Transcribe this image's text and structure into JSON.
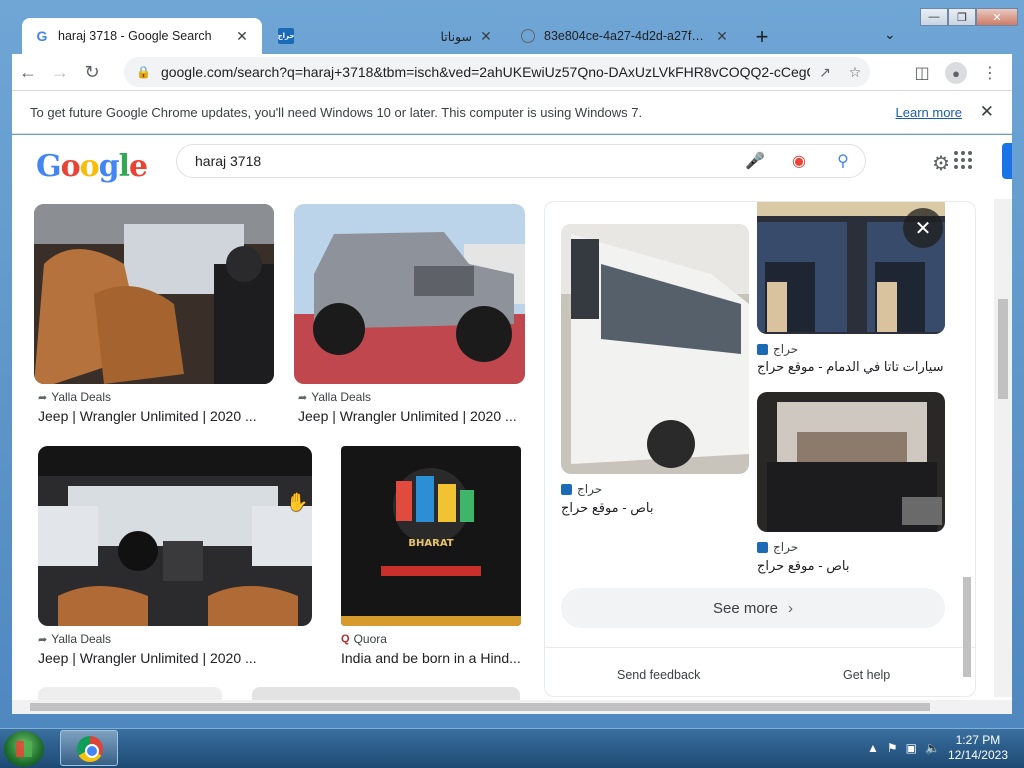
{
  "browser": {
    "tabs": [
      {
        "title": "haraj 3718 - Google Search",
        "favicon": "google-icon",
        "active": true
      },
      {
        "title": "",
        "favicon": "haraj-icon",
        "active": false
      },
      {
        "title": "سوناتا",
        "favicon": "none",
        "active": false
      },
      {
        "title": "83e804ce-4a27-4d2d-a27f-8e97",
        "favicon": "globe-icon",
        "active": false
      }
    ],
    "address": "google.com/search?q=haraj+3718&tbm=isch&ved=2ahUKEwiUz57Qno-DAxUzLVkFHR8vCOQQ2-cCegQIAB...",
    "infobar": {
      "message": "To get future Google Chrome updates, you'll need Windows 10 or later. This computer is using Windows 7.",
      "link": "Learn more"
    }
  },
  "search": {
    "logo_text": "Google",
    "query": "haraj 3718"
  },
  "results": [
    {
      "source": "Yalla Deals",
      "title": "Jeep | Wrangler Unlimited | 2020 ..."
    },
    {
      "source": "Yalla Deals",
      "title": "Jeep | Wrangler Unlimited | 2020 ..."
    },
    {
      "source": "Yalla Deals",
      "title": "Jeep | Wrangler Unlimited | 2020 ..."
    },
    {
      "source": "Quora",
      "title": "India and be born in a Hind..."
    }
  ],
  "panel": {
    "items": [
      {
        "source": "حراج",
        "title": "باص - موقع حراج"
      },
      {
        "source": "حراج",
        "title": "سيارات تاتا في الدمام - موقع حراج"
      },
      {
        "source": "حراج",
        "title": "باص - موقع حراج"
      }
    ],
    "see_more": "See more",
    "feedback": "Send feedback",
    "help": "Get help"
  },
  "taskbar": {
    "time": "1:27 PM",
    "date": "12/14/2023"
  },
  "colors": {
    "google_blue": "#4285f4",
    "google_red": "#ea4335",
    "google_yellow": "#fbbc05",
    "google_green": "#34a853",
    "link_blue": "#1a5ea8"
  }
}
